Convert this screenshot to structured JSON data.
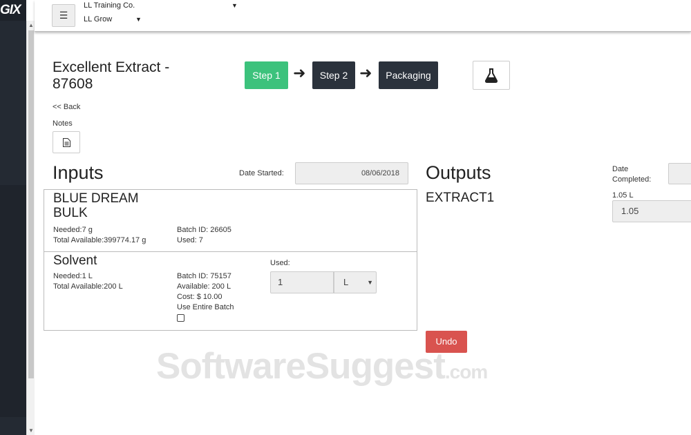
{
  "sidebar": {
    "logo": "GIX"
  },
  "topbar": {
    "menu_icon": "hamburger-icon",
    "company": "LL Training Co.",
    "facility": "LL Grow"
  },
  "page": {
    "title": "Excellent Extract - 87608",
    "steps": [
      "Step 1",
      "Step 2",
      "Packaging"
    ],
    "active_step_color": "#3cc27c",
    "inactive_step_color": "#2b323c",
    "lab_icon": "flask-icon",
    "back": "<< Back",
    "notes_label": "Notes",
    "notes_icon": "document-icon"
  },
  "inputs": {
    "heading": "Inputs",
    "date_started_label": "Date Started:",
    "date_started_value": "08/06/2018",
    "items": [
      {
        "name": "BLUE DREAM BULK",
        "needed": "Needed:7 g",
        "total_available": "Total Available:399774.17 g",
        "batch_id": "Batch ID: 26605",
        "used": "Used: 7"
      },
      {
        "name": "Solvent",
        "needed": "Needed:1 L",
        "total_available": "Total Available:200 L",
        "batch_id": "Batch ID: 75157",
        "available": "Available: 200 L",
        "cost": "Cost: $ 10.00",
        "use_entire_batch": "Use Entire Batch",
        "used_label": "Used:",
        "used_value": "1",
        "unit": "L"
      }
    ]
  },
  "outputs": {
    "heading": "Outputs",
    "name": "EXTRACT1",
    "date_completed_label": "Date Completed:",
    "qty_label": "1.05 L",
    "qty_value": "1.05",
    "undo_label": "Undo",
    "undo_color": "#d9534f"
  },
  "watermark": {
    "main": "SoftwareSuggest",
    "suffix": ".com"
  }
}
